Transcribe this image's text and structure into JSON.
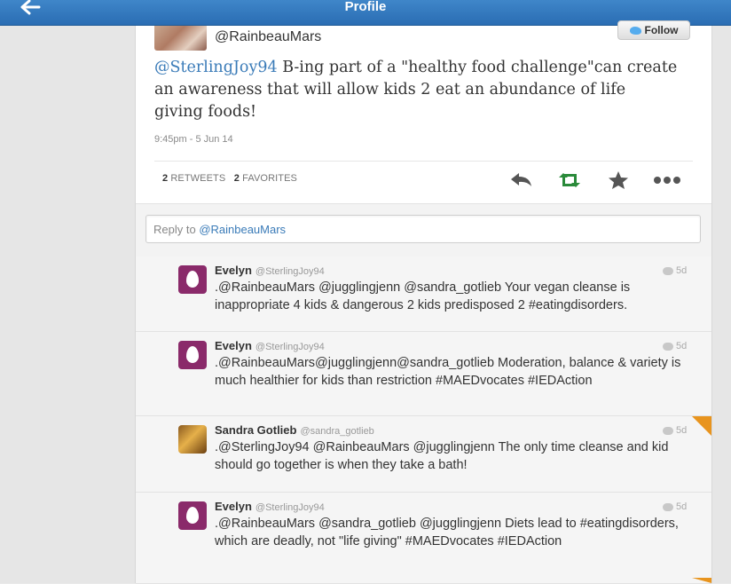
{
  "header": {
    "title": "Profile"
  },
  "tweet": {
    "handle": "@RainbeauMars",
    "follow_label": "Follow",
    "mention": "@SterlingJoy94",
    "text": " B-ing part of a \"healthy food challenge\"can create an awareness that will allow kids 2 eat an abundance of life giving foods!",
    "timestamp": "9:45pm - 5 Jun 14",
    "retweets_count": "2",
    "retweets_label": "RETWEETS",
    "favorites_count": "2",
    "favorites_label": "FAVORITES"
  },
  "reply_box": {
    "prefix": "Reply to ",
    "mention": "@RainbeauMars"
  },
  "replies": [
    {
      "name": "Evelyn",
      "username": "@SterlingJoy94",
      "age": "5d",
      "text": ".@RainbeauMars @jugglingjenn @sandra_gotlieb Your vegan cleanse is inappropriate 4 kids & dangerous 2 kids predisposed 2 #eatingdisorders."
    },
    {
      "name": "Evelyn",
      "username": "@SterlingJoy94",
      "age": "5d",
      "text": ".@RainbeauMars@jugglingjenn@sandra_gotlieb Moderation, balance & variety is much healthier for kids than restriction #MAEDvocates #IEDAction"
    },
    {
      "name": "Sandra Gotlieb",
      "username": "@sandra_gotlieb",
      "age": "5d",
      "text": ".@SterlingJoy94 @RainbeauMars @jugglingjenn The only time cleanse and kid should go together is when they take a bath!"
    },
    {
      "name": "Evelyn",
      "username": "@SterlingJoy94",
      "age": "5d",
      "text": ".@RainbeauMars @sandra_gotlieb @jugglingjenn Diets lead to #eatingdisorders, which are deadly, not \"life giving\" #MAEDvocates #IEDAction"
    }
  ],
  "icons": {
    "back": "arrow-left-icon",
    "reply": "reply-icon",
    "retweet": "retweet-icon",
    "favorite": "star-icon",
    "more": "more-icon",
    "conversation": "speech-bubble-icon"
  },
  "colors": {
    "header": "#2f74bb",
    "link": "#3a7bb8",
    "retweet_green": "#2a8a3a",
    "avatar_egg": "#8a2a6a",
    "corner_badge": "#e8941e"
  }
}
